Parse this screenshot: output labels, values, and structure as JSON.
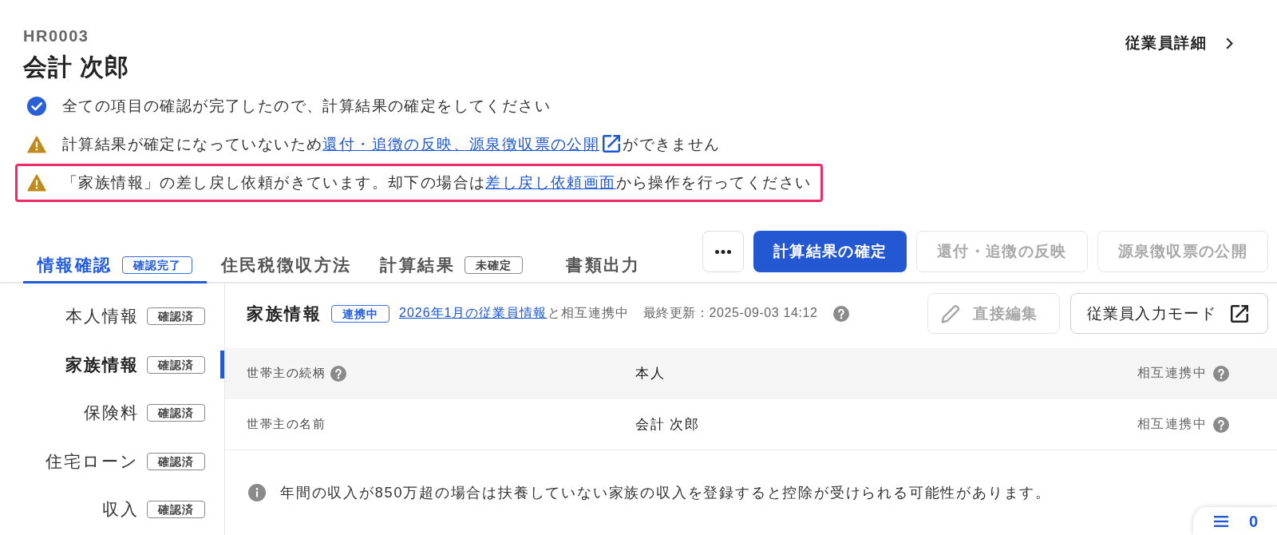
{
  "employee": {
    "code": "HR0003",
    "name": "会計 次郎"
  },
  "detail_link": {
    "label": "従業員詳細"
  },
  "alerts": [
    {
      "kind": "success",
      "highlighted": false,
      "parts": [
        {
          "text": "全ての項目の確認が完了したので、計算結果の確定をしてください"
        }
      ]
    },
    {
      "kind": "warning",
      "highlighted": false,
      "parts": [
        {
          "text": "計算結果が確定になっていないため"
        },
        {
          "link": "還付・追徴の反映、源泉徴収票の公開",
          "external": true
        },
        {
          "text": "ができません"
        }
      ]
    },
    {
      "kind": "warning",
      "highlighted": true,
      "parts": [
        {
          "text": "「家族情報」の差し戻し依頼がきています。却下の場合は"
        },
        {
          "link": "差し戻し依頼画面",
          "external": false
        },
        {
          "text": "から操作を行ってください"
        }
      ]
    }
  ],
  "tabs": [
    {
      "label": "情報確認",
      "selected": true,
      "badge": "確認完了"
    },
    {
      "label": "住民税徴収方法",
      "selected": false
    },
    {
      "label": "計算結果",
      "selected": false,
      "badge": "未確定"
    },
    {
      "label": "書類出力",
      "selected": false
    }
  ],
  "actions": [
    {
      "kind": "more",
      "disabled": false
    },
    {
      "kind": "primary",
      "label": "計算結果の確定",
      "disabled": false
    },
    {
      "kind": "secondary",
      "label": "還付・追徴の反映",
      "disabled": true
    },
    {
      "kind": "secondary",
      "label": "源泉徴収票の公開",
      "disabled": true
    }
  ],
  "sidebar": {
    "items": [
      {
        "label": "本人情報",
        "badge": "確認済",
        "selected": false
      },
      {
        "label": "家族情報",
        "badge": "確認済",
        "selected": true
      },
      {
        "label": "保険料",
        "badge": "確認済",
        "selected": false
      },
      {
        "label": "住宅ローン",
        "badge": "確認済",
        "selected": false
      },
      {
        "label": "収入",
        "badge": "確認済",
        "selected": false
      }
    ]
  },
  "panel": {
    "title": "家族情報",
    "status_badge": "連携中",
    "sync_link": "2026年1月の従業員情報",
    "sync_suffix": "と相互連携中",
    "updated": "最終更新：2025-09-03 14:12",
    "buttons": [
      {
        "kind": "edit",
        "label": "直接編集",
        "disabled": true
      },
      {
        "kind": "external",
        "label": "従業員入力モード",
        "disabled": false
      }
    ],
    "rows": [
      {
        "label": "世帯主の続柄",
        "help": true,
        "value": "本人",
        "sync": "相互連携中"
      },
      {
        "label": "世帯主の名前",
        "help": false,
        "value": "会計 次郎",
        "sync": "相互連携中"
      }
    ],
    "note": "年間の収入が850万超の場合は扶養していない家族の収入を登録すると控除が受けられる可能性があります。"
  },
  "floating_panel": {
    "count": "0"
  }
}
